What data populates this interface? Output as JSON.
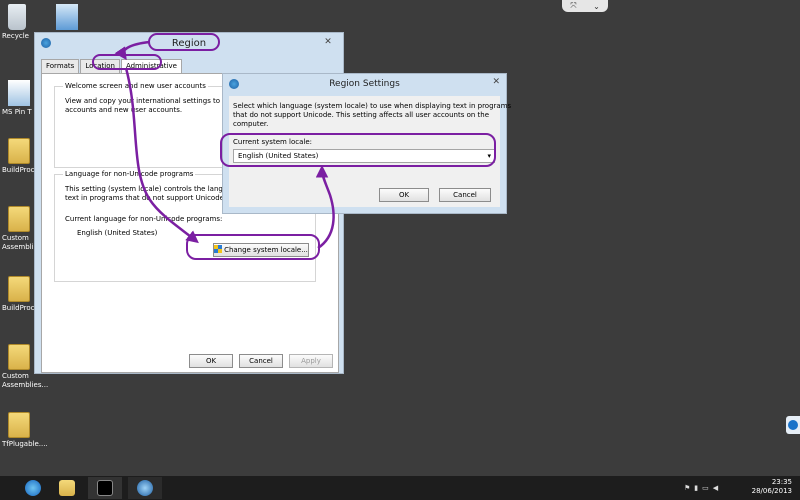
{
  "desktop": {
    "icons": [
      {
        "label": "Recycle"
      },
      {
        "label": "MS Pin T"
      },
      {
        "label": "BuildProc"
      },
      {
        "label": "Custom\nAssembli"
      },
      {
        "label": "BuildProc"
      },
      {
        "label": "Custom\nAssemblies..."
      },
      {
        "label": "TfPlugable...."
      }
    ]
  },
  "top_pill": {
    "glyph_left": "⤧",
    "glyph_right": "⌄"
  },
  "region_window": {
    "title": "Region",
    "close_glyph": "✕",
    "tabs": [
      {
        "label": "Formats"
      },
      {
        "label": "Location"
      },
      {
        "label": "Administrative"
      }
    ],
    "welcome_group": {
      "title": "Welcome screen and new user accounts",
      "text_line1": "View and copy your international settings to the w",
      "text_line2": "accounts and new user accounts."
    },
    "unicode_group": {
      "title": "Language for non-Unicode programs",
      "text_line1": "This setting (system locale) controls the language",
      "text_line2": "text in programs that do not support Unicode.",
      "current_label": "Current language for non-Unicode programs:",
      "current_value": "English (United States)",
      "change_button": "Change system locale..."
    },
    "buttons": {
      "ok": "OK",
      "cancel": "Cancel",
      "apply": "Apply"
    }
  },
  "region_settings": {
    "title": "Region Settings",
    "close_glyph": "✕",
    "description_line1": "Select which language (system locale) to use when displaying text in programs",
    "description_line2": "that do not support Unicode. This setting affects all user accounts on the",
    "description_line3": "computer.",
    "locale_label": "Current system locale:",
    "locale_value": "English (United States)",
    "buttons": {
      "ok": "OK",
      "cancel": "Cancel"
    }
  },
  "taskbar": {
    "time": "23:35",
    "date": "28/06/2013"
  },
  "colors": {
    "annotation": "#7b1fa2",
    "desktop": "#3c3c3c",
    "taskbar": "#1d1d1d"
  }
}
